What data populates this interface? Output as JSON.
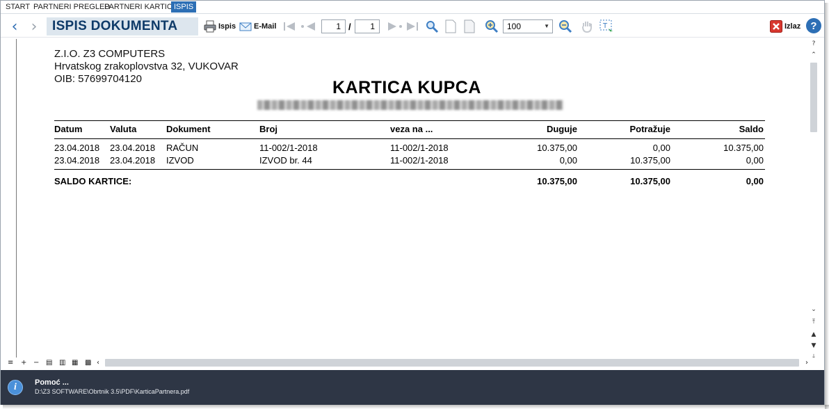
{
  "menu": {
    "items": [
      "START",
      "PARTNERI PREGLED",
      "PARTNERI KARTICA",
      "ISPIS"
    ]
  },
  "toolbar": {
    "title": "ISPIS DOKUMENTA",
    "print_label": "Ispis",
    "email_label": "E-Mail",
    "current_page": "1",
    "page_separator": "/",
    "total_pages": "1",
    "zoom_value": "100",
    "exit_label": "Izlaz"
  },
  "document": {
    "company_name": "Z.I.O. Z3 COMPUTERS",
    "company_address": "Hrvatskog zrakoplovstva 32, VUKOVAR",
    "company_oib": "OIB: 57699704120",
    "title": "KARTICA KUPCA",
    "columns": [
      "Datum",
      "Valuta",
      "Dokument",
      "Broj",
      "veza na ...",
      "Duguje",
      "Potražuje",
      "Saldo"
    ],
    "rows": [
      [
        "23.04.2018",
        "23.04.2018",
        "RAČUN",
        "11-002/1-2018",
        "11-002/1-2018",
        "10.375,00",
        "0,00",
        "10.375,00"
      ],
      [
        "23.04.2018",
        "23.04.2018",
        "IZVOD",
        "IZVOD br. 44",
        "11-002/1-2018",
        "0,00",
        "10.375,00",
        "0,00"
      ]
    ],
    "footer": {
      "label": "SALDO KARTICE:",
      "duguje": "10.375,00",
      "potrazuje": "10.375,00",
      "saldo": "0,00"
    }
  },
  "status": {
    "title": "Pomoć ...",
    "path": "D:\\Z3 SOFTWARE\\Obrtnik 3.5\\PDF\\KarticaPartnera.pdf"
  },
  "colors": {
    "active_tab": "#2d6fb5",
    "title_bg": "#dde6ee",
    "title_text": "#0e3a68",
    "status_bg": "#2e3645"
  }
}
